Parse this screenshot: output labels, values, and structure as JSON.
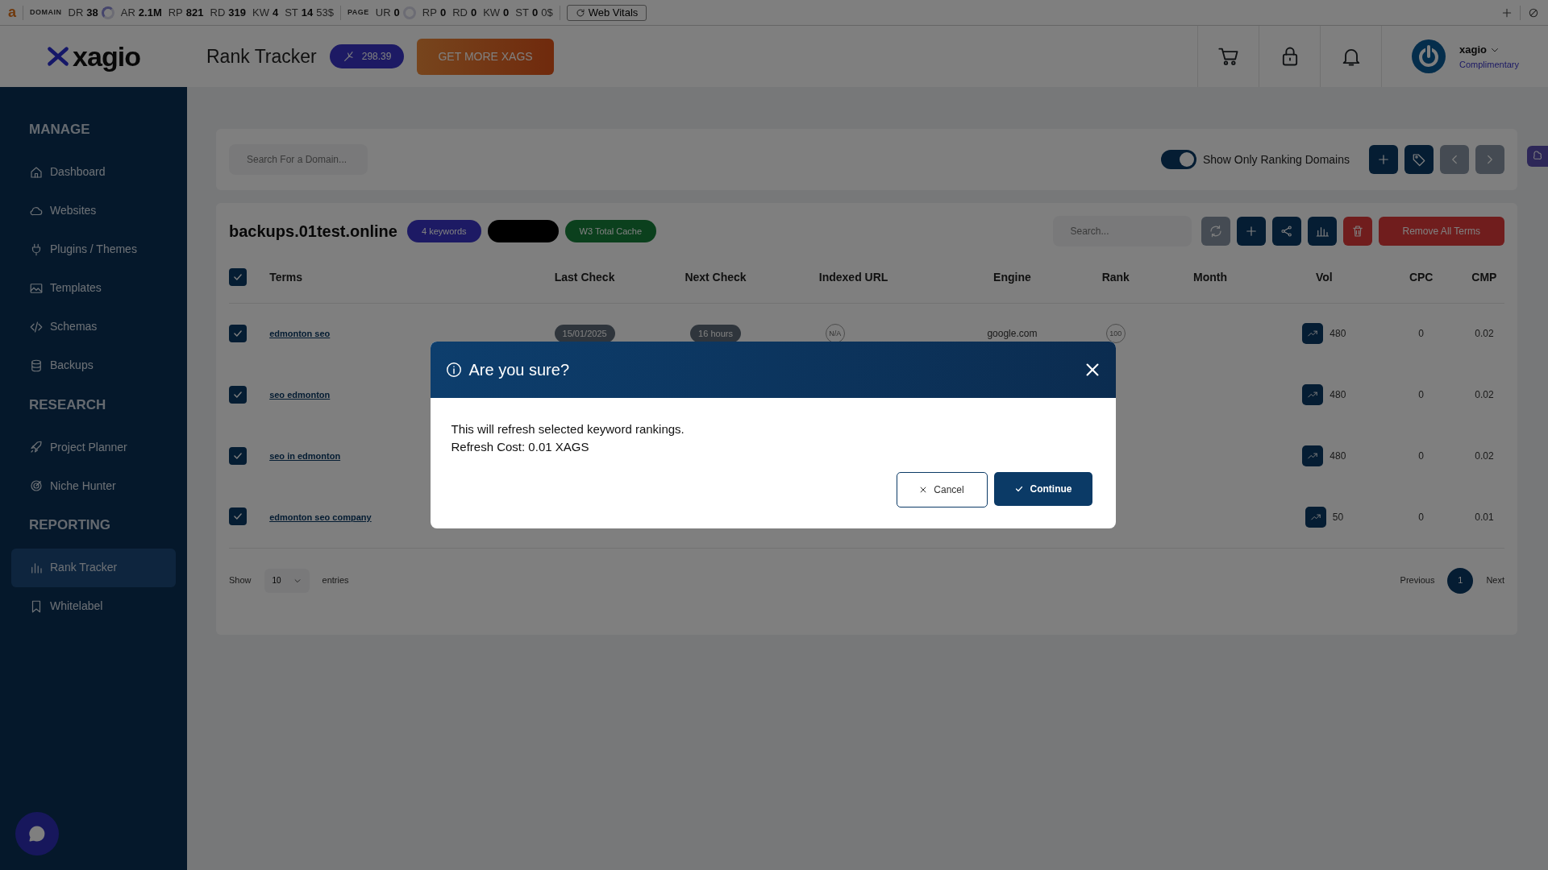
{
  "ext_bar": {
    "logo": "a",
    "domain_label": "DOMAIN",
    "domain_metrics": [
      {
        "key": "DR",
        "value": "38",
        "kind": "ring"
      },
      {
        "key": "AR",
        "value": "2.1M",
        "kind": "plain"
      },
      {
        "key": "RP",
        "value": "821",
        "kind": "plain"
      },
      {
        "key": "RD",
        "value": "319",
        "kind": "plain"
      },
      {
        "key": "KW",
        "value": "4",
        "kind": "plain"
      },
      {
        "key": "ST",
        "value": "14",
        "extra": "53$",
        "kind": "plain"
      }
    ],
    "page_label": "PAGE",
    "page_metrics": [
      {
        "key": "UR",
        "value": "0",
        "kind": "ring"
      },
      {
        "key": "RP",
        "value": "0",
        "kind": "plain"
      },
      {
        "key": "RD",
        "value": "0",
        "kind": "plain"
      },
      {
        "key": "KW",
        "value": "0",
        "kind": "plain"
      },
      {
        "key": "ST",
        "value": "0",
        "extra": "0$",
        "kind": "plain"
      }
    ],
    "vitals_button": "Web Vitals"
  },
  "header": {
    "brand": "xagio",
    "title": "Rank Tracker",
    "balance": "298.39",
    "cta": "GET MORE XAGS",
    "user": {
      "name": "xagio",
      "plan": "Complimentary"
    }
  },
  "sidebar": {
    "sections": [
      {
        "heading": "MANAGE",
        "items": [
          {
            "label": "Dashboard",
            "selected": false
          },
          {
            "label": "Websites",
            "selected": false
          },
          {
            "label": "Plugins / Themes",
            "selected": false
          },
          {
            "label": "Templates",
            "selected": false
          },
          {
            "label": "Schemas",
            "selected": false
          },
          {
            "label": "Backups",
            "selected": false
          }
        ]
      },
      {
        "heading": "RESEARCH",
        "items": [
          {
            "label": "Project Planner",
            "selected": false
          },
          {
            "label": "Niche Hunter",
            "selected": false
          }
        ]
      },
      {
        "heading": "REPORTING",
        "items": [
          {
            "label": "Rank Tracker",
            "selected": true
          },
          {
            "label": "Whitelabel",
            "selected": false
          }
        ]
      }
    ]
  },
  "domain_bar": {
    "search_placeholder": "Search For a Domain...",
    "toggle": {
      "label": "Show Only Ranking Domains",
      "on": true
    }
  },
  "project": {
    "domain": "backups.01test.online",
    "badges": [
      {
        "kind": "text",
        "label": "4 keywords"
      },
      {
        "kind": "redacted"
      },
      {
        "kind": "text",
        "label": "W3 Total Cache"
      }
    ],
    "search_placeholder": "Search...",
    "remove_button": "Remove All Terms"
  },
  "table": {
    "all_checked": true,
    "columns": [
      "Terms",
      "Last Check",
      "Next Check",
      "Indexed URL",
      "Engine",
      "Rank",
      "Month",
      "Vol",
      "CPC",
      "CMP"
    ],
    "rows": [
      {
        "checked": true,
        "term": "edmonton seo",
        "last_check": "15/01/2025",
        "next_check": "16 hours",
        "indexed_url": "N/A",
        "engine": "google.com",
        "rank": "100",
        "vol": "480",
        "cpc": "0",
        "cmp": "0.02"
      },
      {
        "checked": true,
        "term": "seo edmonton",
        "vol": "480",
        "cpc": "0",
        "cmp": "0.02"
      },
      {
        "checked": true,
        "term": "seo in edmonton",
        "vol": "480",
        "cpc": "0",
        "cmp": "0.02"
      },
      {
        "checked": true,
        "term": "edmonton seo company",
        "vol": "50",
        "cpc": "0",
        "cmp": "0.01"
      }
    ]
  },
  "footer": {
    "show_label": "Show",
    "page_size": "10",
    "entries_label": "entries",
    "previous": "Previous",
    "pages": [
      {
        "label": "1",
        "selected": true
      }
    ],
    "next": "Next"
  },
  "modal": {
    "title": "Are you sure?",
    "lines": [
      "This will refresh selected keyword rankings.",
      "Refresh Cost: 0.01 XAGS"
    ],
    "cancel": "Cancel",
    "continue": "Continue"
  }
}
